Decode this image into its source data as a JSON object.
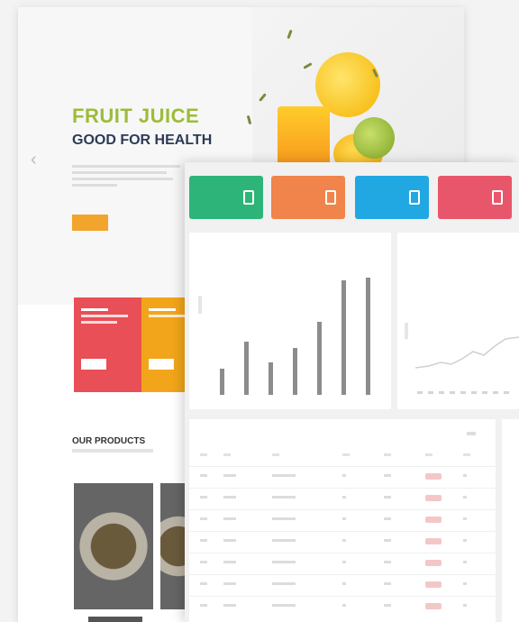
{
  "website": {
    "tagline": "",
    "hero_title": "FRUIT JUICE",
    "hero_subtitle": "GOOD FOR HEALTH",
    "hero_paragraph": "",
    "cta_label": "",
    "section_title": "OUR PRODUCTS",
    "colors": {
      "green": "#9cbc3a",
      "navy": "#2d3a57",
      "orange": "#f2a42d",
      "red": "#e84f56",
      "yellow": "#f2a51a"
    }
  },
  "dashboard": {
    "stat_cards": [
      {
        "label": "",
        "value": "",
        "color": "#2db579",
        "icon": "clipboard-icon"
      },
      {
        "label": "",
        "value": "",
        "color": "#f0844a",
        "icon": "clipboard-icon"
      },
      {
        "label": "",
        "value": "",
        "color": "#21a8e3",
        "icon": "clipboard-icon"
      },
      {
        "label": "",
        "value": "",
        "color": "#e8566b",
        "icon": "clipboard-icon"
      }
    ],
    "bar_panel": {
      "title": "",
      "control": ""
    },
    "line_panel": {
      "title": ""
    },
    "table_panel": {
      "title": ""
    },
    "bar_fill": [
      0.22,
      0.45,
      0.28,
      0.4,
      0.62,
      0.98,
      1.0
    ]
  }
}
